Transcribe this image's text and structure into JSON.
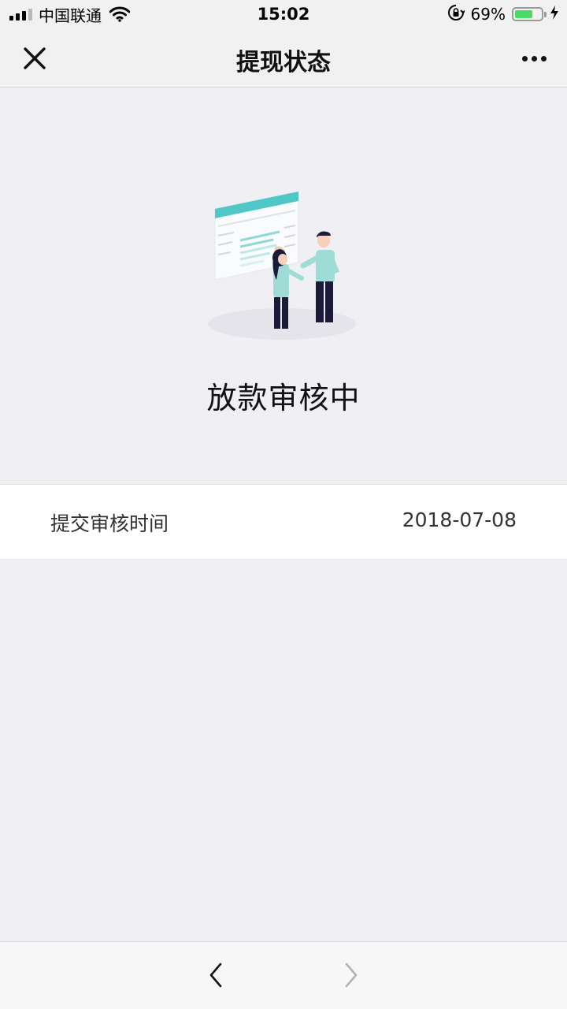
{
  "status_bar": {
    "carrier": "中国联通",
    "time": "15:02",
    "battery_percent": "69%",
    "battery_level": 0.69,
    "signal_bars": 4,
    "signal_bars_active": 3,
    "icons": [
      "signal-icon",
      "wifi-icon",
      "orientation-lock-icon",
      "battery-icon",
      "charging-icon"
    ]
  },
  "nav": {
    "title": "提现状态",
    "close_icon": "close-icon",
    "more_icon": "more-icon"
  },
  "hero": {
    "illustration": "review-illustration",
    "status_text": "放款审核中"
  },
  "info": {
    "label": "提交审核时间",
    "value": "2018-07-08"
  },
  "toolbar": {
    "back_icon": "chevron-left-icon",
    "forward_icon": "chevron-right-icon",
    "forward_enabled": false
  },
  "colors": {
    "background": "#efeff4",
    "accent": "#4fc7c6",
    "battery_green": "#4cd964"
  }
}
